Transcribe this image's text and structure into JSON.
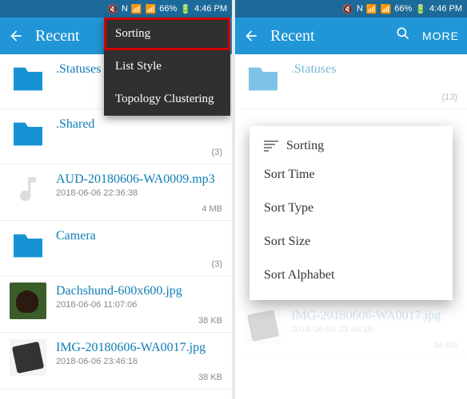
{
  "status": {
    "mute_icon": "🔇",
    "nfc": "N",
    "wifi_icon": "📶",
    "signal_icon": "📶",
    "battery_pct": "66%",
    "battery_icon": "🔋",
    "time": "4:46 PM"
  },
  "header": {
    "title": "Recent",
    "more_label": "MORE"
  },
  "dropdown": {
    "items": [
      "Sorting",
      "List Style",
      "Topology Clustering"
    ]
  },
  "sort_dialog": {
    "title": "Sorting",
    "items": [
      "Sort Time",
      "Sort Type",
      "Sort Size",
      "Sort Alphabet"
    ]
  },
  "rows": [
    {
      "name": ".Statuses",
      "type": "folder",
      "count": "(13)"
    },
    {
      "name": ".Shared",
      "type": "folder",
      "count": "(3)"
    },
    {
      "name": "AUD-20180606-WA0009.mp3",
      "type": "audio",
      "sub": "2018-06-06 22:36:38",
      "meta": "4 MB"
    },
    {
      "name": "Camera",
      "type": "folder",
      "count": "(3)"
    },
    {
      "name": "Dachshund-600x600.jpg",
      "type": "image-dog",
      "sub": "2018-06-06 11:07:06",
      "meta": "38 KB"
    },
    {
      "name": "IMG-20180606-WA0017.jpg",
      "type": "image-notebook",
      "sub": "2018-06-06 23:46:16",
      "meta": "38 KB"
    }
  ],
  "right_rows": [
    {
      "name": ".Statuses",
      "type": "folder",
      "count": "(13)"
    },
    {
      "name": "IMG-20180606-WA0017.jpg",
      "type": "image-notebook",
      "sub": "2018-06-06 23:46:16",
      "meta": "34 KB"
    }
  ]
}
